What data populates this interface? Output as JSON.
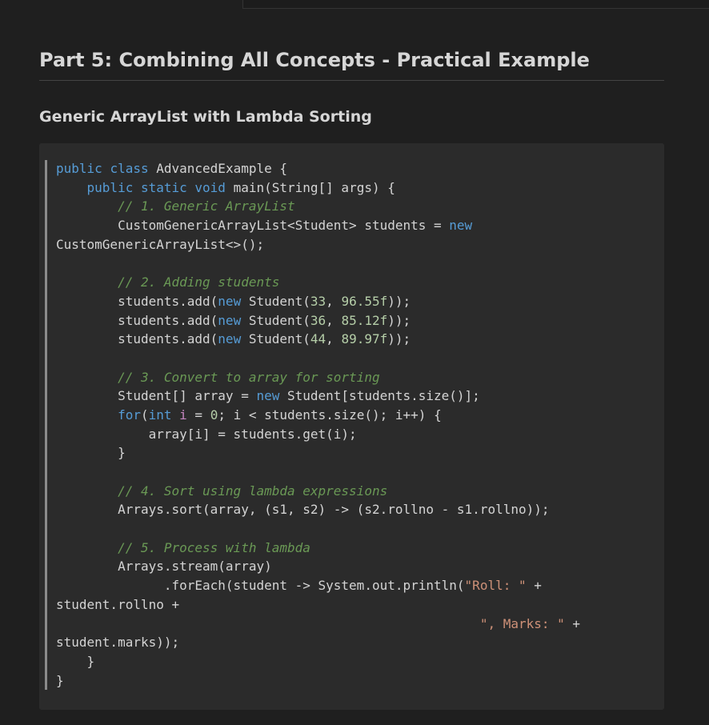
{
  "section_title": "Part 5: Combining All Concepts - Practical Example",
  "subsection_title": "Generic ArrayList with Lambda Sorting",
  "code": {
    "language": "java",
    "lines": [
      [
        {
          "t": "public",
          "c": "kw"
        },
        {
          "t": " "
        },
        {
          "t": "class",
          "c": "kw"
        },
        {
          "t": " AdvancedExample {"
        }
      ],
      [
        {
          "t": "    "
        },
        {
          "t": "public",
          "c": "kw"
        },
        {
          "t": " "
        },
        {
          "t": "static",
          "c": "kw"
        },
        {
          "t": " "
        },
        {
          "t": "void",
          "c": "kw"
        },
        {
          "t": " main(String[] args) {"
        }
      ],
      [
        {
          "t": "        "
        },
        {
          "t": "// 1. Generic ArrayList",
          "c": "cm"
        }
      ],
      [
        {
          "t": "        CustomGenericArrayList<Student> students = "
        },
        {
          "t": "new",
          "c": "kw"
        }
      ],
      [
        {
          "t": "CustomGenericArrayList<>();"
        }
      ],
      [
        {
          "t": ""
        }
      ],
      [
        {
          "t": "        "
        },
        {
          "t": "// 2. Adding students",
          "c": "cm"
        }
      ],
      [
        {
          "t": "        students.add("
        },
        {
          "t": "new",
          "c": "kw"
        },
        {
          "t": " Student("
        },
        {
          "t": "33",
          "c": "num"
        },
        {
          "t": ", "
        },
        {
          "t": "96.55f",
          "c": "num"
        },
        {
          "t": "));"
        }
      ],
      [
        {
          "t": "        students.add("
        },
        {
          "t": "new",
          "c": "kw"
        },
        {
          "t": " Student("
        },
        {
          "t": "36",
          "c": "num"
        },
        {
          "t": ", "
        },
        {
          "t": "85.12f",
          "c": "num"
        },
        {
          "t": "));"
        }
      ],
      [
        {
          "t": "        students.add("
        },
        {
          "t": "new",
          "c": "kw"
        },
        {
          "t": " Student("
        },
        {
          "t": "44",
          "c": "num"
        },
        {
          "t": ", "
        },
        {
          "t": "89.97f",
          "c": "num"
        },
        {
          "t": "));"
        }
      ],
      [
        {
          "t": ""
        }
      ],
      [
        {
          "t": "        "
        },
        {
          "t": "// 3. Convert to array for sorting",
          "c": "cm"
        }
      ],
      [
        {
          "t": "        Student[] array = "
        },
        {
          "t": "new",
          "c": "kw"
        },
        {
          "t": " Student[students.size()];"
        }
      ],
      [
        {
          "t": "        "
        },
        {
          "t": "for",
          "c": "kw"
        },
        {
          "t": "("
        },
        {
          "t": "int",
          "c": "kw"
        },
        {
          "t": " "
        },
        {
          "t": "i",
          "c": "var"
        },
        {
          "t": " = "
        },
        {
          "t": "0",
          "c": "num"
        },
        {
          "t": "; i < students.size(); i++) {"
        }
      ],
      [
        {
          "t": "            array[i] = students.get(i);"
        }
      ],
      [
        {
          "t": "        }"
        }
      ],
      [
        {
          "t": ""
        }
      ],
      [
        {
          "t": "        "
        },
        {
          "t": "// 4. Sort using lambda expressions",
          "c": "cm"
        }
      ],
      [
        {
          "t": "        Arrays.sort(array, (s1, s2) -> (s2.rollno - s1.rollno));"
        }
      ],
      [
        {
          "t": ""
        }
      ],
      [
        {
          "t": "        "
        },
        {
          "t": "// 5. Process with lambda",
          "c": "cm"
        }
      ],
      [
        {
          "t": "        Arrays.stream(array)"
        }
      ],
      [
        {
          "t": "              .forEach(student -> System.out.println("
        },
        {
          "t": "\"Roll: \"",
          "c": "str"
        },
        {
          "t": " +"
        }
      ],
      [
        {
          "t": "student.rollno +"
        }
      ],
      [
        {
          "t": "                                                       "
        },
        {
          "t": "\", Marks: \"",
          "c": "str"
        },
        {
          "t": " +"
        }
      ],
      [
        {
          "t": "student.marks));"
        }
      ],
      [
        {
          "t": "    }"
        }
      ],
      [
        {
          "t": "}"
        }
      ]
    ]
  }
}
